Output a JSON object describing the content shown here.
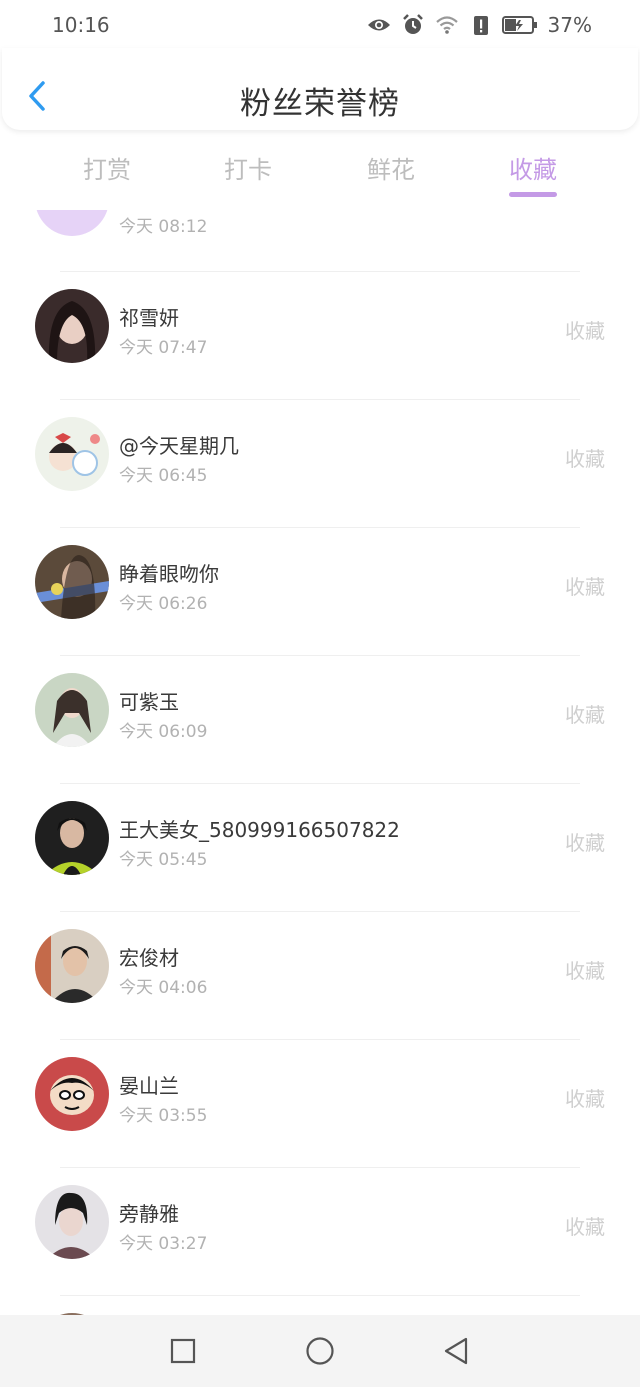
{
  "status_bar": {
    "time": "10:16",
    "battery": "37%",
    "icons": [
      "eye-icon",
      "alarm-icon",
      "wifi-icon",
      "alert-icon",
      "battery-icon"
    ]
  },
  "header": {
    "title": "粉丝荣誉榜",
    "back_icon": "chevron-left-icon"
  },
  "tabs": [
    {
      "label": "打赏",
      "active": false
    },
    {
      "label": "打卡",
      "active": false
    },
    {
      "label": "鲜花",
      "active": false
    },
    {
      "label": "收藏",
      "active": true
    }
  ],
  "list": {
    "partial_top_time": "今天 08:12",
    "items": [
      {
        "name": "祁雪妍",
        "time": "今天 07:47",
        "action": "收藏"
      },
      {
        "name": "@今天星期几",
        "time": "今天 06:45",
        "action": "收藏"
      },
      {
        "name": "睁着眼吻你",
        "time": "今天 06:26",
        "action": "收藏"
      },
      {
        "name": "可紫玉",
        "time": "今天 06:09",
        "action": "收藏"
      },
      {
        "name": "王大美女_580999166507822",
        "time": "今天 05:45",
        "action": "收藏"
      },
      {
        "name": "宏俊材",
        "time": "今天 04:06",
        "action": "收藏"
      },
      {
        "name": "晏山兰",
        "time": "今天 03:55",
        "action": "收藏"
      },
      {
        "name": "旁静雅",
        "time": "今天 03:27",
        "action": "收藏"
      }
    ]
  },
  "nav_bar": {
    "icons": [
      "square-icon",
      "circle-home-icon",
      "triangle-back-icon"
    ]
  },
  "colors": {
    "accent": "#c49ae6",
    "back_arrow": "#2f9bf0",
    "muted": "#bdbdbd"
  }
}
